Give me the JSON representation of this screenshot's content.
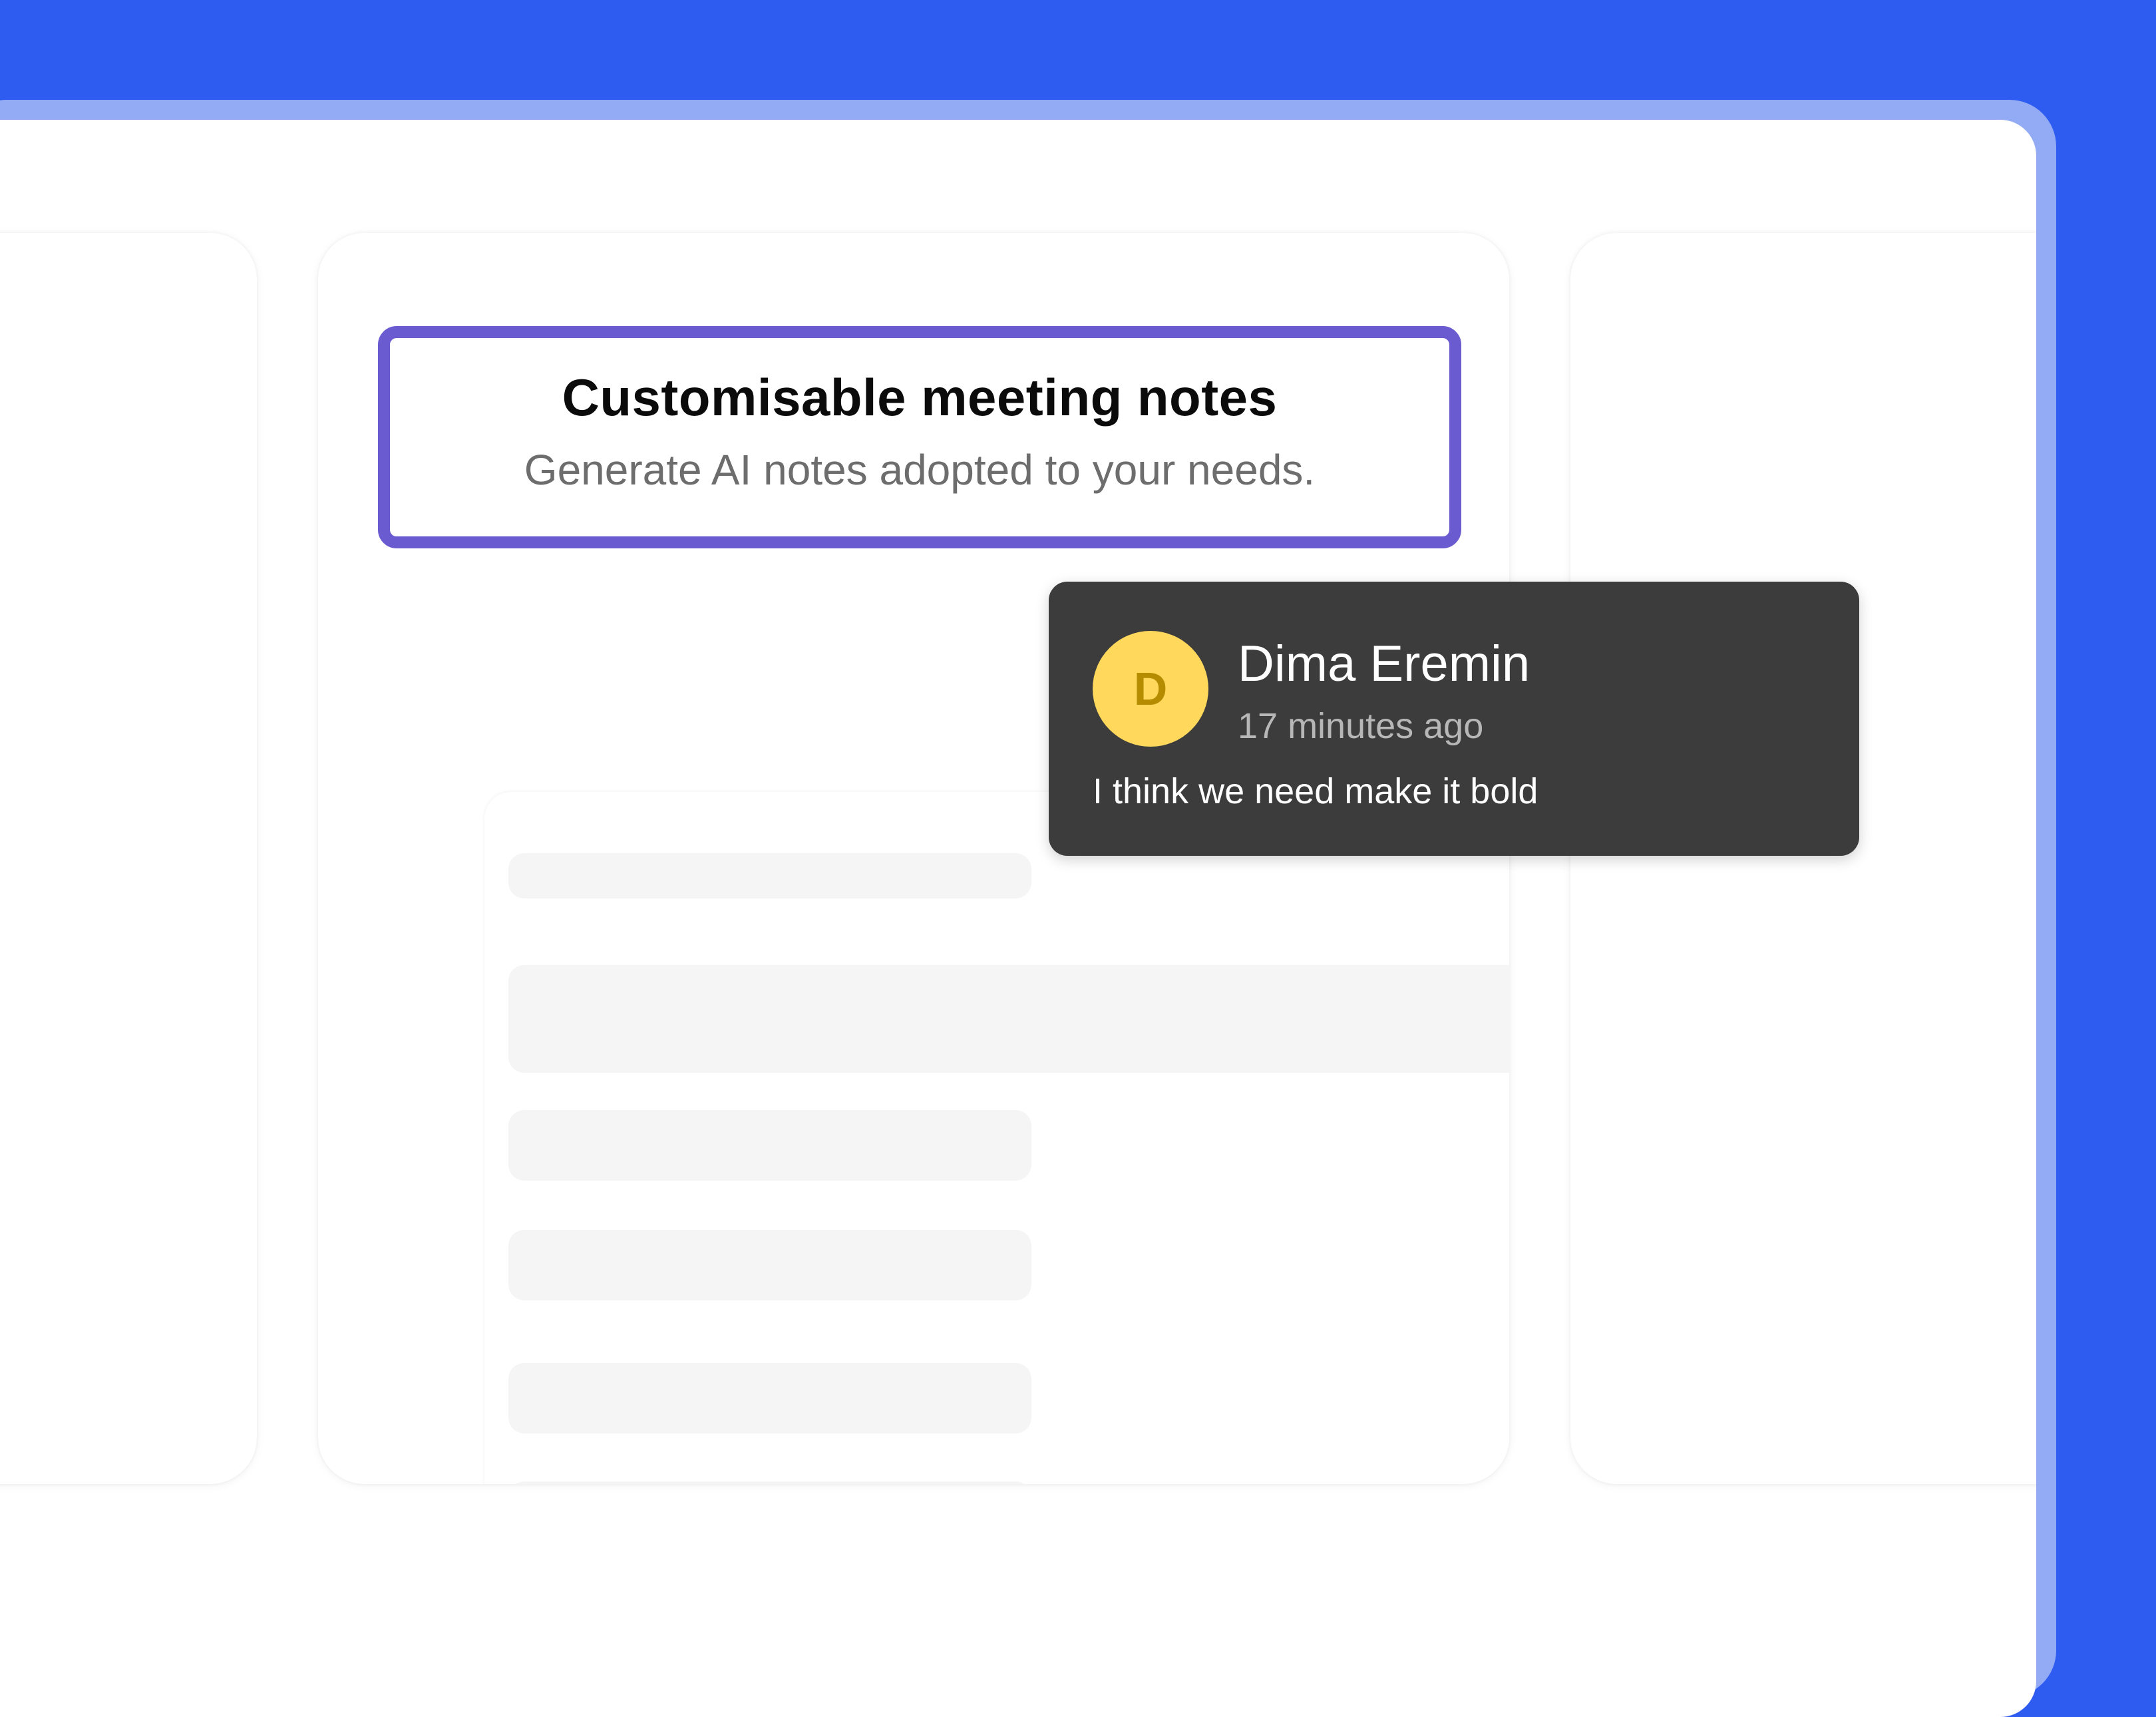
{
  "feature": {
    "title": "Customisable meeting notes",
    "subtitle": "Generate AI notes adopted to your needs."
  },
  "comment": {
    "avatar_initial": "D",
    "author": "Dima Eremin",
    "time": "17 minutes ago",
    "text": "I think we need make it bold"
  },
  "colors": {
    "background": "#2f5cf0",
    "highlight_border": "#6a5bd0",
    "comment_bg": "#3c3c3c",
    "avatar_bg": "#ffd85c",
    "avatar_text": "#b58c00"
  }
}
